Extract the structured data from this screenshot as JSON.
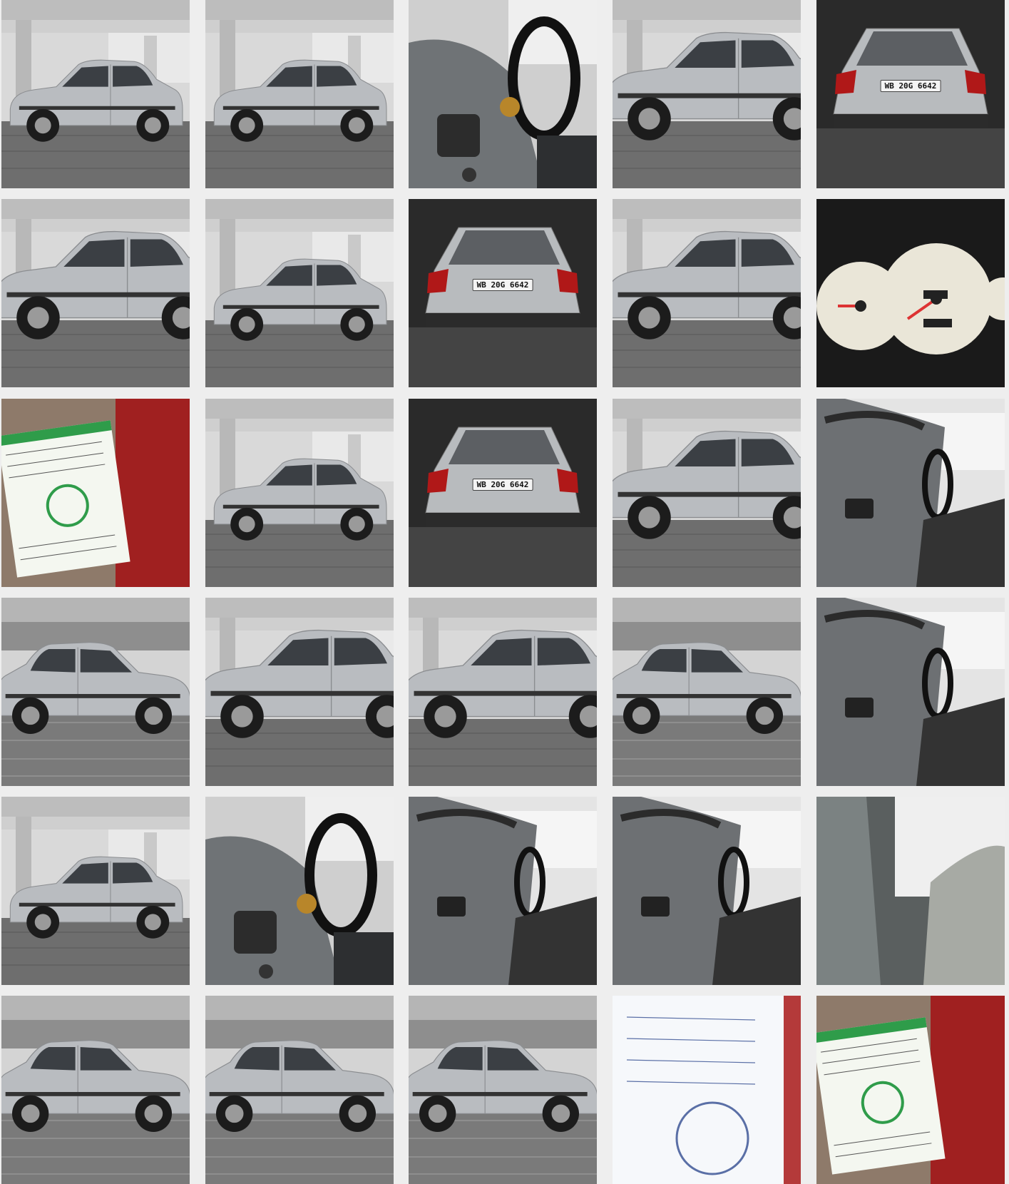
{
  "gallery": {
    "tiles": [
      {
        "kind": "side-left"
      },
      {
        "kind": "side-left"
      },
      {
        "kind": "dashboard"
      },
      {
        "kind": "side-close"
      },
      {
        "kind": "rear-dark",
        "plate": "WB 20G 6642"
      },
      {
        "kind": "side-close"
      },
      {
        "kind": "side-left"
      },
      {
        "kind": "rear-dark",
        "plate": "WB 20G 6642"
      },
      {
        "kind": "side-close"
      },
      {
        "kind": "speedometer"
      },
      {
        "kind": "document-card"
      },
      {
        "kind": "side-left"
      },
      {
        "kind": "rear-dark",
        "plate": "WB 20G 6642"
      },
      {
        "kind": "side-close"
      },
      {
        "kind": "interior-door"
      },
      {
        "kind": "side-right"
      },
      {
        "kind": "side-close"
      },
      {
        "kind": "side-close"
      },
      {
        "kind": "side-right"
      },
      {
        "kind": "interior-door"
      },
      {
        "kind": "side-left"
      },
      {
        "kind": "dashboard"
      },
      {
        "kind": "interior-door"
      },
      {
        "kind": "interior-door"
      },
      {
        "kind": "rear-seat"
      },
      {
        "kind": "side-right"
      },
      {
        "kind": "side-right"
      },
      {
        "kind": "side-right"
      },
      {
        "kind": "document-paper"
      },
      {
        "kind": "document-card"
      }
    ]
  }
}
